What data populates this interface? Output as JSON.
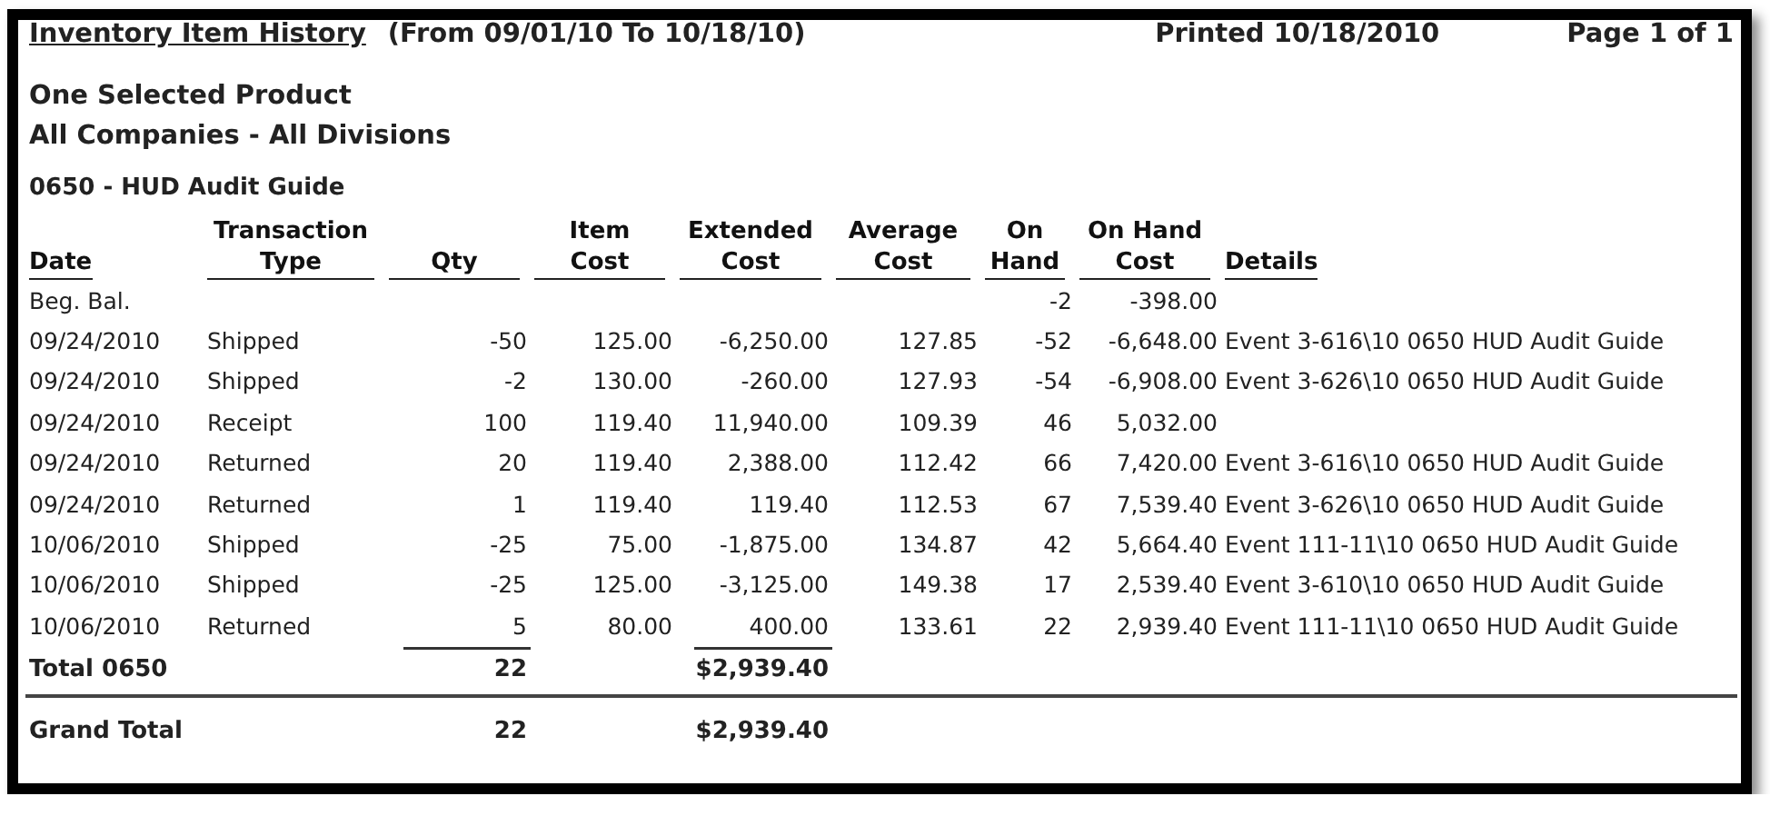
{
  "report": {
    "title": "Inventory Item History",
    "date_range": "(From 09/01/10 To 10/18/10)",
    "printed": "Printed 10/18/2010",
    "page": "Page 1 of 1",
    "subtitles": [
      "One Selected Product",
      "All Companies - All Divisions"
    ],
    "product": "0650 - HUD Audit Guide"
  },
  "table": {
    "columns": [
      {
        "lines": [
          "Date"
        ]
      },
      {
        "lines": [
          "Transaction",
          "Type"
        ]
      },
      {
        "lines": [
          "Qty"
        ]
      },
      {
        "lines": [
          "Item",
          "Cost"
        ]
      },
      {
        "lines": [
          "Extended",
          "Cost"
        ]
      },
      {
        "lines": [
          "Average",
          "Cost"
        ]
      },
      {
        "lines": [
          "On",
          "Hand"
        ]
      },
      {
        "lines": [
          "On Hand",
          "Cost"
        ]
      },
      {
        "lines": [
          "Details"
        ]
      }
    ],
    "rows": [
      {
        "date": "Beg. Bal.",
        "on_hand": "-2",
        "on_hand_cost": "-398.00"
      },
      {
        "date": "09/24/2010",
        "type": "Shipped",
        "qty": "-50",
        "item_cost": "125.00",
        "extended_cost": "-6,250.00",
        "average_cost": "127.85",
        "on_hand": "-52",
        "on_hand_cost": "-6,648.00",
        "details": "Event 3-616\\10 0650 HUD Audit Guide"
      },
      {
        "date": "09/24/2010",
        "type": "Shipped",
        "qty": "-2",
        "item_cost": "130.00",
        "extended_cost": "-260.00",
        "average_cost": "127.93",
        "on_hand": "-54",
        "on_hand_cost": "-6,908.00",
        "details": "Event 3-626\\10 0650 HUD Audit Guide"
      },
      {
        "date": "09/24/2010",
        "type": "Receipt",
        "qty": "100",
        "item_cost": "119.40",
        "extended_cost": "11,940.00",
        "average_cost": "109.39",
        "on_hand": "46",
        "on_hand_cost": "5,032.00"
      },
      {
        "date": "09/24/2010",
        "type": "Returned",
        "qty": "20",
        "item_cost": "119.40",
        "extended_cost": "2,388.00",
        "average_cost": "112.42",
        "on_hand": "66",
        "on_hand_cost": "7,420.00",
        "details": "Event 3-616\\10 0650 HUD Audit Guide"
      },
      {
        "date": "09/24/2010",
        "type": "Returned",
        "qty": "1",
        "item_cost": "119.40",
        "extended_cost": "119.40",
        "average_cost": "112.53",
        "on_hand": "67",
        "on_hand_cost": "7,539.40",
        "details": "Event 3-626\\10 0650 HUD Audit Guide"
      },
      {
        "date": "10/06/2010",
        "type": "Shipped",
        "qty": "-25",
        "item_cost": "75.00",
        "extended_cost": "-1,875.00",
        "average_cost": "134.87",
        "on_hand": "42",
        "on_hand_cost": "5,664.40",
        "details": "Event 111-11\\10 0650 HUD Audit Guide"
      },
      {
        "date": "10/06/2010",
        "type": "Shipped",
        "qty": "-25",
        "item_cost": "125.00",
        "extended_cost": "-3,125.00",
        "average_cost": "149.38",
        "on_hand": "17",
        "on_hand_cost": "2,539.40",
        "details": "Event 3-610\\10 0650 HUD Audit Guide"
      },
      {
        "date": "10/06/2010",
        "type": "Returned",
        "qty": "5",
        "item_cost": "80.00",
        "extended_cost": "400.00",
        "average_cost": "133.61",
        "on_hand": "22",
        "on_hand_cost": "2,939.40",
        "details": "Event 111-11\\10 0650 HUD Audit Guide"
      }
    ],
    "total": {
      "label": "Total 0650",
      "qty": "22",
      "extended_cost": "$2,939.40"
    },
    "grand_total": {
      "label": "Grand Total",
      "qty": "22",
      "extended_cost": "$2,939.40"
    }
  }
}
